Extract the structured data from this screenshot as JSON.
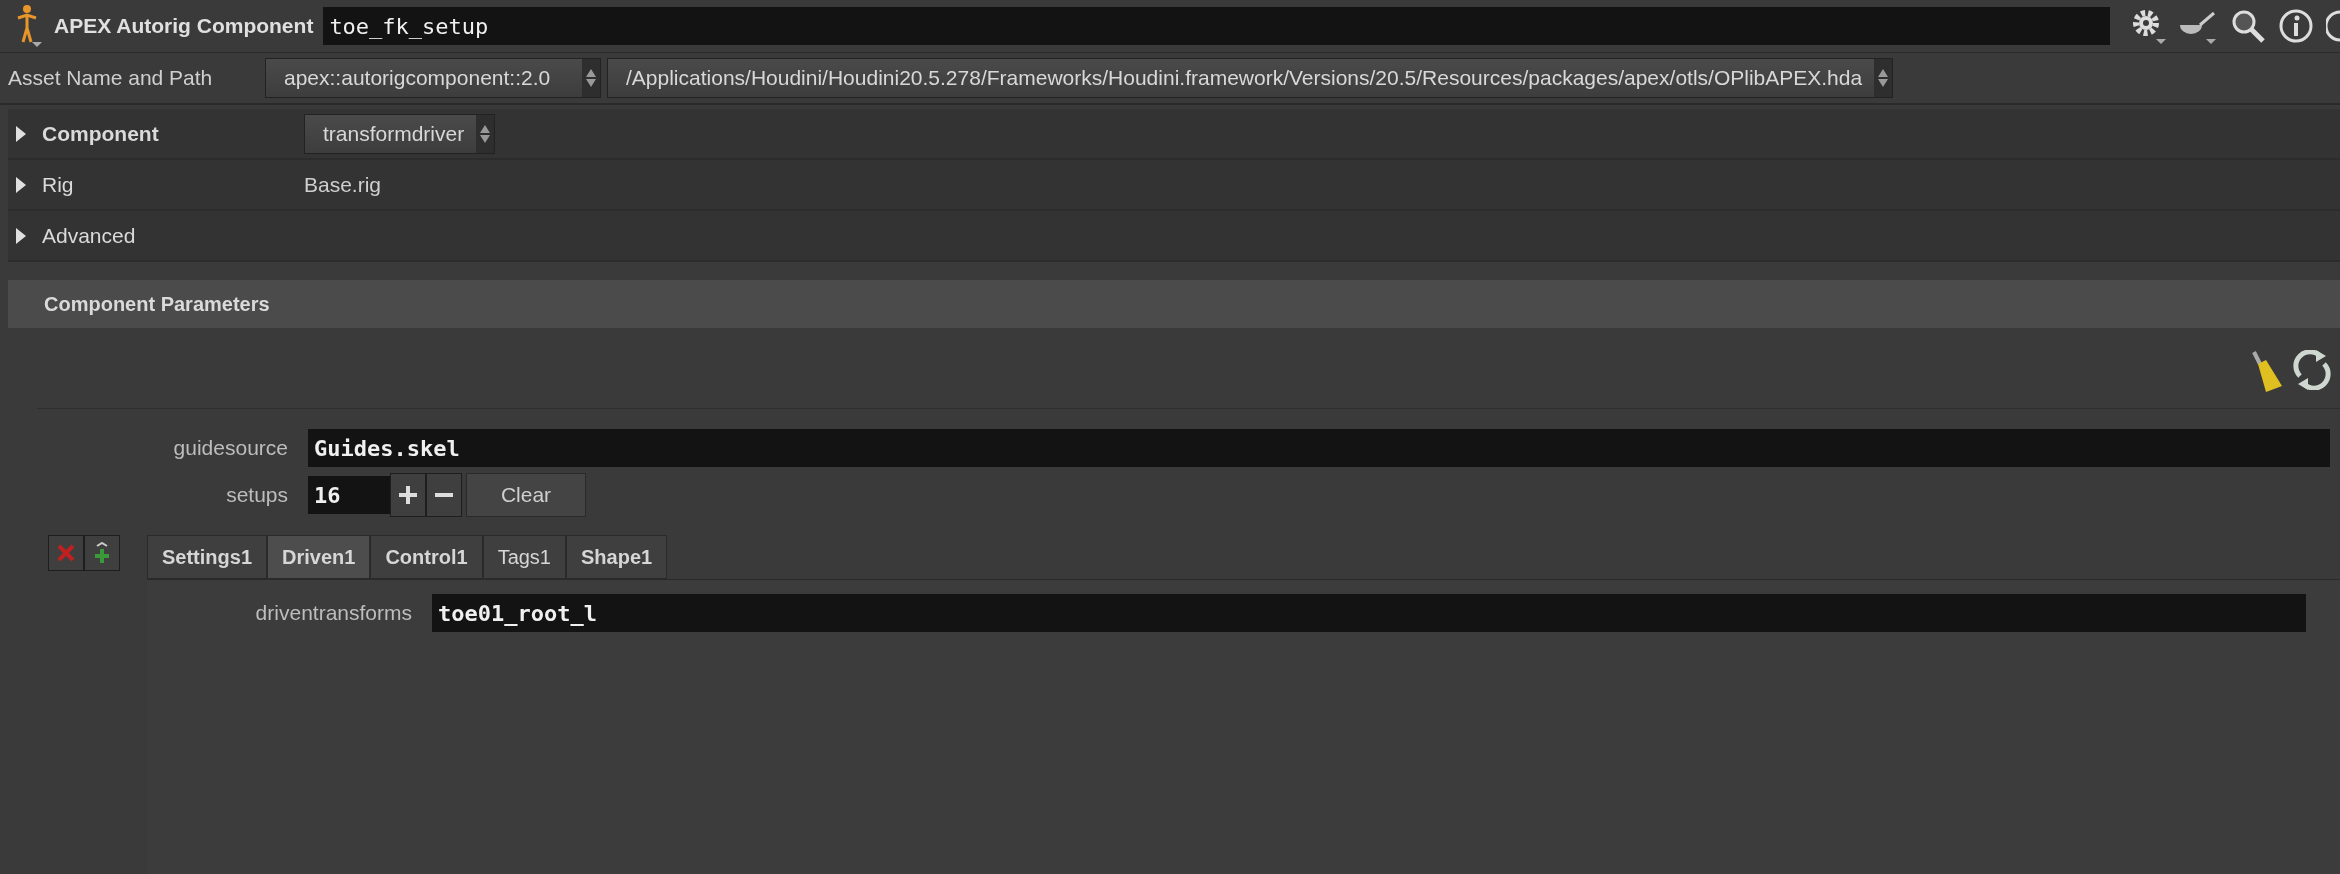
{
  "header": {
    "title": "APEX Autorig Component",
    "node_name": "toe_fk_setup"
  },
  "asset": {
    "label": "Asset Name and Path",
    "name": "apex::autorigcomponent::2.0",
    "path": "/Applications/Houdini/Houdini20.5.278/Frameworks/Houdini.framework/Versions/20.5/Resources/packages/apex/otls/OPlibAPEX.hda"
  },
  "sections": [
    {
      "label": "Component",
      "expanded": false,
      "modified": true,
      "kind": "menu",
      "value": "transformdriver"
    },
    {
      "label": "Rig",
      "expanded": false,
      "modified": false,
      "kind": "text",
      "value": "Base.rig"
    },
    {
      "label": "Advanced",
      "expanded": false,
      "modified": false,
      "kind": "empty"
    }
  ],
  "parameters_title": "Component Parameters",
  "guidesource": {
    "label": "guidesource",
    "value": "Guides.skel"
  },
  "setups": {
    "label": "setups",
    "value": "16",
    "clear": "Clear"
  },
  "tabs": [
    {
      "label": "Settings1",
      "selected": false,
      "modified": true
    },
    {
      "label": "Driven1",
      "selected": true,
      "modified": true
    },
    {
      "label": "Control1",
      "selected": false,
      "modified": true
    },
    {
      "label": "Tags1",
      "selected": false,
      "modified": false
    },
    {
      "label": "Shape1",
      "selected": false,
      "modified": true
    }
  ],
  "driven": {
    "label": "driventransforms",
    "value": "toe01_root_l"
  }
}
